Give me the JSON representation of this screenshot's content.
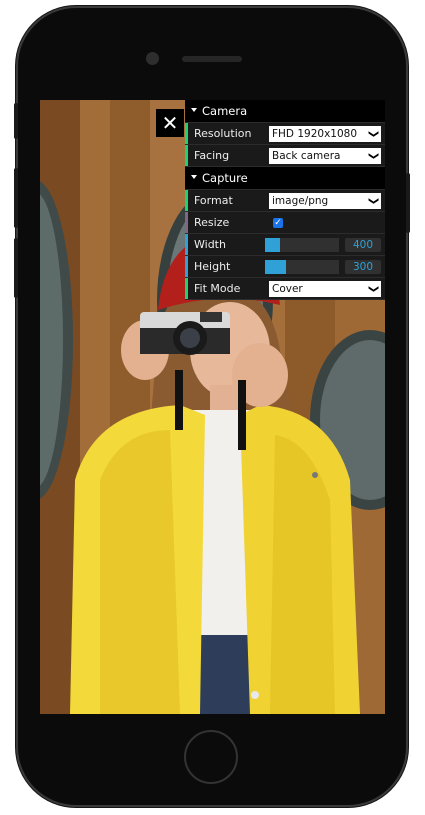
{
  "close_glyph": "✕",
  "gui": {
    "camera_folder": {
      "title": "Camera",
      "resolution": {
        "label": "Resolution",
        "value": "FHD 1920x1080"
      },
      "facing": {
        "label": "Facing",
        "value": "Back camera"
      }
    },
    "capture_folder": {
      "title": "Capture",
      "format": {
        "label": "Format",
        "value": "image/png"
      },
      "resize": {
        "label": "Resize",
        "checked": true
      },
      "width": {
        "label": "Width",
        "value": "400",
        "fraction": 0.2
      },
      "height": {
        "label": "Height",
        "value": "300",
        "fraction": 0.28
      },
      "fit_mode": {
        "label": "Fit Mode",
        "value": "Cover"
      }
    }
  },
  "colors": {
    "string_stripe": "#1ed36f",
    "bool_stripe": "#806787",
    "number_stripe": "#2fa1d6",
    "slider_fill": "#2fa1d6"
  }
}
